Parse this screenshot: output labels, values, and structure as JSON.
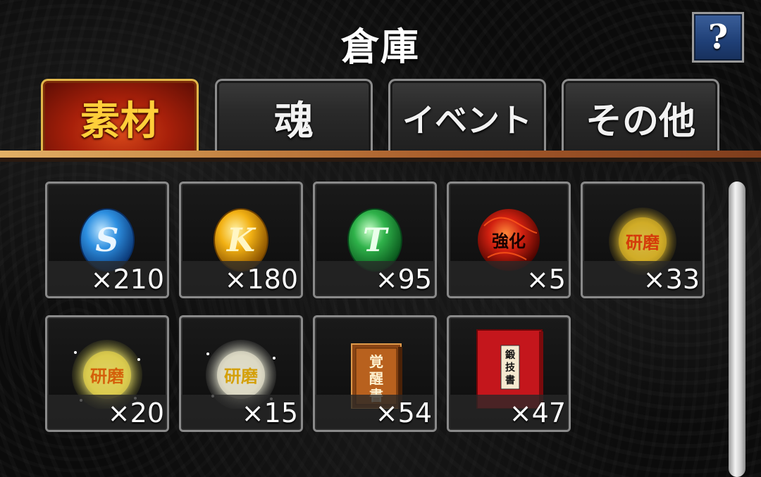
{
  "header": {
    "title": "倉庫",
    "help_label": "?"
  },
  "tabs": [
    {
      "label": "素材",
      "active": true
    },
    {
      "label": "魂",
      "active": false
    },
    {
      "label": "イベント",
      "active": false
    },
    {
      "label": "その他",
      "active": false
    }
  ],
  "items": [
    {
      "icon": "blue-s-coin-icon",
      "count": "×210",
      "color": "#2d8fe0"
    },
    {
      "icon": "gold-k-coin-icon",
      "count": "×180",
      "color": "#f2b114"
    },
    {
      "icon": "green-t-coin-icon",
      "count": "×95",
      "color": "#2fb24a"
    },
    {
      "icon": "red-enhance-orb-icon",
      "count": "×5",
      "color": "#d12010"
    },
    {
      "icon": "gold-research-orb-icon",
      "count": "×33",
      "color": "#e8c232"
    },
    {
      "icon": "yellow-research-orb-icon",
      "count": "×20",
      "color": "#eadf6a"
    },
    {
      "icon": "white-research-orb-icon",
      "count": "×15",
      "color": "#e8e8d0"
    },
    {
      "icon": "awakening-book-icon",
      "count": "×54",
      "color": "#b8611e"
    },
    {
      "icon": "skill-book-icon",
      "count": "×47",
      "color": "#c4161c"
    }
  ]
}
